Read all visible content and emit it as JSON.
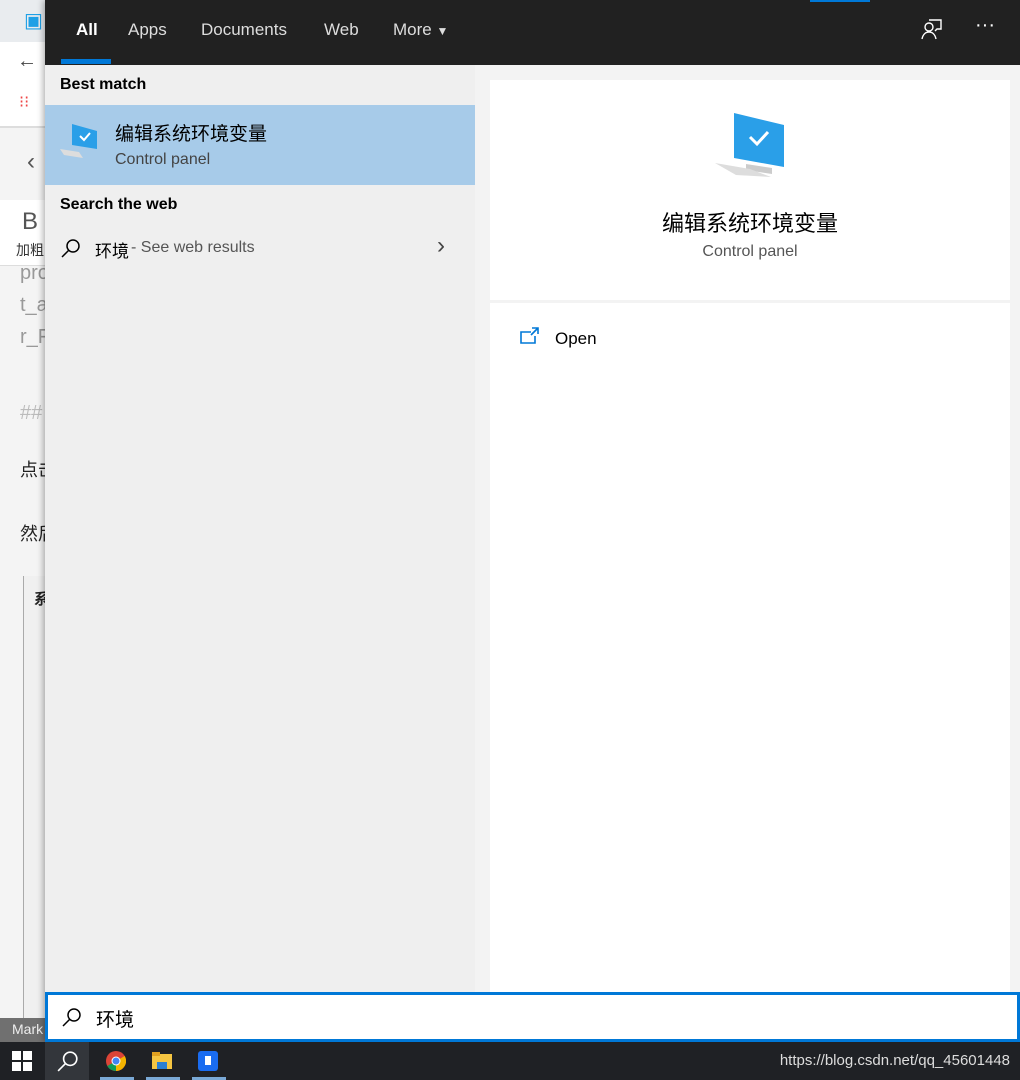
{
  "background": {
    "lines": [
      "pro",
      "t_a",
      "r_F",
      "##",
      "点击",
      "然后",
      "系"
    ],
    "bold_button": "B",
    "bold_label": "加粗",
    "status": "Mark"
  },
  "tabs": [
    {
      "label": "All",
      "active": true
    },
    {
      "label": "Apps"
    },
    {
      "label": "Documents"
    },
    {
      "label": "Web"
    },
    {
      "label": "More"
    }
  ],
  "header_icons": [
    "feedback-icon",
    "more-options-icon"
  ],
  "best_match": {
    "heading": "Best match",
    "title": "编辑系统环境变量",
    "subtitle": "Control panel"
  },
  "web_search": {
    "heading": "Search the web",
    "query": "环境",
    "suffix": " - See web results"
  },
  "preview": {
    "title": "编辑系统环境变量",
    "subtitle": "Control panel",
    "actions": [
      {
        "label": "Open",
        "icon": "open-icon"
      }
    ]
  },
  "search_box": {
    "value": "环境"
  },
  "taskbar": {
    "items": [
      "start-icon",
      "search-icon",
      "chrome-icon",
      "file-explorer-icon",
      "app-icon"
    ]
  },
  "watermark": "https://blog.csdn.net/qq_45601448",
  "colors": {
    "accent": "#0078d7",
    "selection": "#a7cbe9",
    "header": "#212121"
  }
}
